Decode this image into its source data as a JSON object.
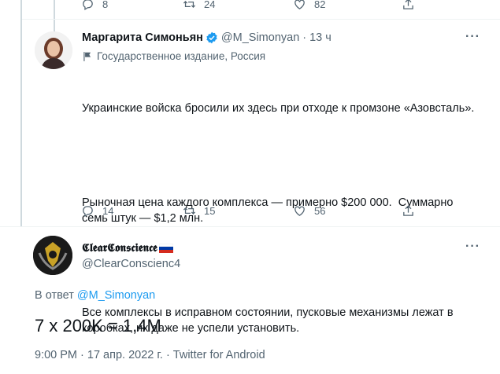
{
  "top_tweet": {
    "reply_count": "8",
    "retweet_count": "24",
    "like_count": "82"
  },
  "tweet": {
    "author_name": "Маргарита Симоньян",
    "handle": "@M_Simonyan",
    "separator": "·",
    "time": "13 ч",
    "more": "···",
    "label": "Государственное издание, Россия",
    "text_p1": "Украинские войска бросили их здесь при отходе к промзоне «Азовсталь».",
    "text_p2": "Рыночная цена каждого комплекса — примерно $200 000.  Суммарно семь штук — $1,2 млн.",
    "text_p3": "Все комплексы в исправном состоянии, пусковые механизмы лежат в коробках, их даже не успели установить.",
    "reply_count": "14",
    "retweet_count": "15",
    "like_count": "56"
  },
  "reply": {
    "author_name": "𝕮𝖑𝖊𝖆𝖗𝕮𝖔𝖓𝖘𝖈𝖎𝖊𝖓𝖈𝖊",
    "handle": "@ClearConscienc4",
    "more": "···",
    "reply_prefix": "В ответ",
    "reply_target": "@M_Simonyan",
    "text": "7 x 200K = 1,4M",
    "meta": "9:00 PM · 17 апр. 2022 г. · Twitter for Android"
  },
  "colors": {
    "accent": "#1d9bf0",
    "secondary_text": "#536471",
    "separator": "#eff3f4"
  }
}
